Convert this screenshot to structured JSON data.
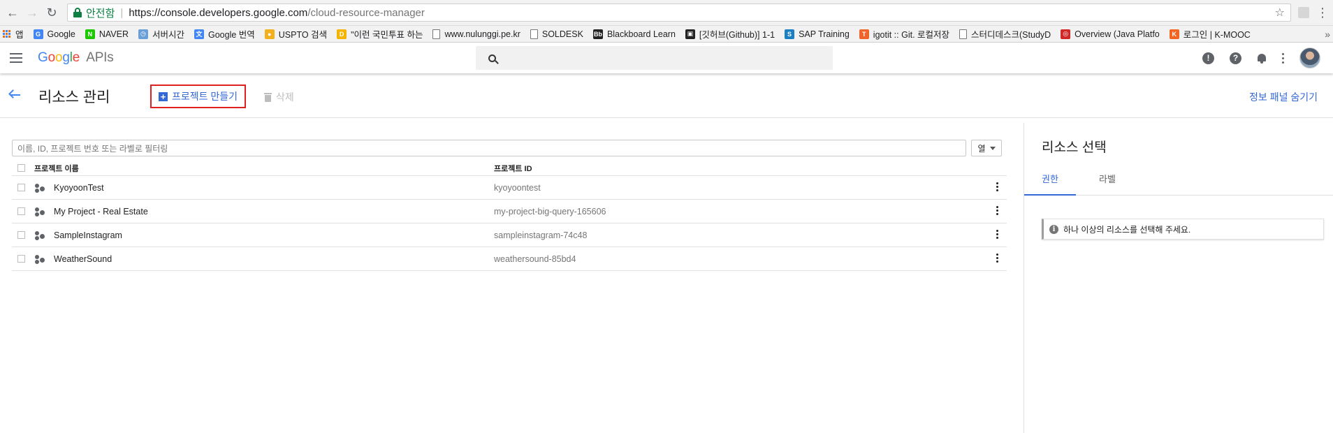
{
  "browser": {
    "secure_label": "안전함",
    "url_host": "https://console.developers.google.com",
    "url_path": "/cloud-resource-manager",
    "bookmarks": [
      {
        "label": "앱",
        "color": "#e8710a"
      },
      {
        "label": "Google",
        "color": "#4285f4",
        "glyph": "G"
      },
      {
        "label": "NAVER",
        "color": "#1ec800",
        "glyph": "N"
      },
      {
        "label": "서버시간",
        "color": "#6a9fd8",
        "glyph": "◷"
      },
      {
        "label": "Google 번역",
        "color": "#4285f4",
        "glyph": "文"
      },
      {
        "label": "USPTO 검색",
        "color": "#f2b01e",
        "glyph": "●"
      },
      {
        "label": "\"이런 국민투표 하는",
        "color": "#f4b400",
        "glyph": "D"
      },
      {
        "label": "www.nulunggi.pe.kr",
        "doc": true
      },
      {
        "label": "SOLDESK",
        "doc": true
      },
      {
        "label": "Blackboard Learn",
        "color": "#222",
        "glyph": "Bb"
      },
      {
        "label": "[깃허브(Github)] 1-1",
        "color": "#222",
        "glyph": "▣"
      },
      {
        "label": "SAP Training",
        "color": "#1b7fc3",
        "glyph": "S"
      },
      {
        "label": "igotit :: Git. 로컬저장",
        "color": "#f0642c",
        "glyph": "T"
      },
      {
        "label": "스터디데스크(StudyD",
        "doc": true
      },
      {
        "label": "Overview (Java Platfo",
        "color": "#d12727",
        "glyph": "◎"
      },
      {
        "label": "로그인 | K-MOOC",
        "color": "#f26522",
        "glyph": "K"
      }
    ],
    "more": "»"
  },
  "header": {
    "logo_word": "Google",
    "logo_suffix": "APIs",
    "search_placeholder": ""
  },
  "toolbar": {
    "title": "리소스 관리",
    "create_label": "프로젝트 만들기",
    "delete_label": "삭제",
    "hide_panel_label": "정보 패널 숨기기"
  },
  "table": {
    "filter_placeholder": "이름, ID, 프로젝트 번호 또는 라벨로 필터링",
    "columns_label": "열",
    "headers": {
      "name": "프로젝트 이름",
      "id": "프로젝트 ID"
    },
    "rows": [
      {
        "name": "KyoyoonTest",
        "id": "kyoyoontest"
      },
      {
        "name": "My Project - Real Estate",
        "id": "my-project-big-query-165606"
      },
      {
        "name": "SampleInstagram",
        "id": "sampleinstagram-74c48"
      },
      {
        "name": "WeatherSound",
        "id": "weathersound-85bd4"
      }
    ]
  },
  "panel": {
    "title": "리소스 선택",
    "tabs": [
      {
        "label": "권한",
        "active": true
      },
      {
        "label": "라벨",
        "active": false
      }
    ],
    "info_message": "하나 이상의 리소스를 선택해 주세요."
  }
}
